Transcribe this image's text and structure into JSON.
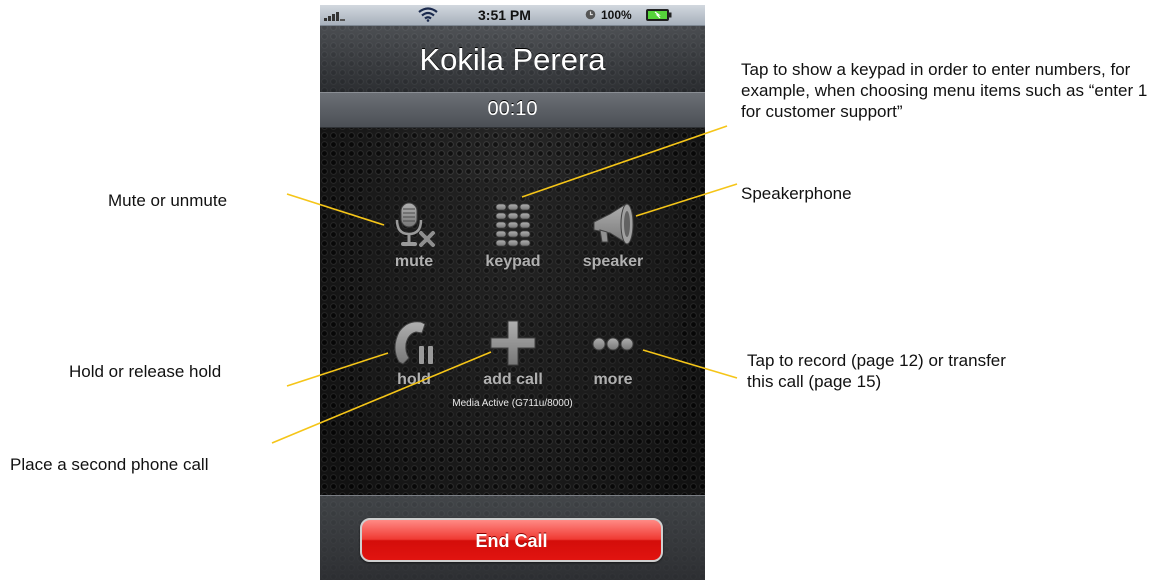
{
  "status_bar": {
    "time": "3:51 PM",
    "battery": "100%",
    "icons": [
      "signal-icon",
      "wifi-icon",
      "clock-icon",
      "battery-icon"
    ]
  },
  "call": {
    "caller_name": "Kokila Perera",
    "timer": "00:10",
    "media_status": "Media Active (G711u/8000)"
  },
  "controls": {
    "mute": {
      "label": "mute",
      "icon": "microphone-muted-icon"
    },
    "keypad": {
      "label": "keypad",
      "icon": "keypad-icon"
    },
    "speaker": {
      "label": "speaker",
      "icon": "megaphone-icon"
    },
    "hold": {
      "label": "hold",
      "icon": "phone-pause-icon"
    },
    "add_call": {
      "label": "add call",
      "icon": "plus-icon"
    },
    "more": {
      "label": "more",
      "icon": "ellipsis-icon"
    }
  },
  "end_call": {
    "label": "End Call",
    "color": "#e8201a"
  },
  "annotations": {
    "keypad": "Tap to show a keypad in order to enter numbers, for example, when choosing menu items such as “enter 1 for customer support”",
    "mute": "Mute or unmute",
    "speaker": "Speakerphone",
    "hold": "Hold or release hold",
    "add_call": "Place a second phone call",
    "more": "Tap to record (page 12) or transfer this call (page 15)"
  },
  "colors": {
    "leader_line": "#f5c518",
    "end_call_red": "#e8201a"
  }
}
